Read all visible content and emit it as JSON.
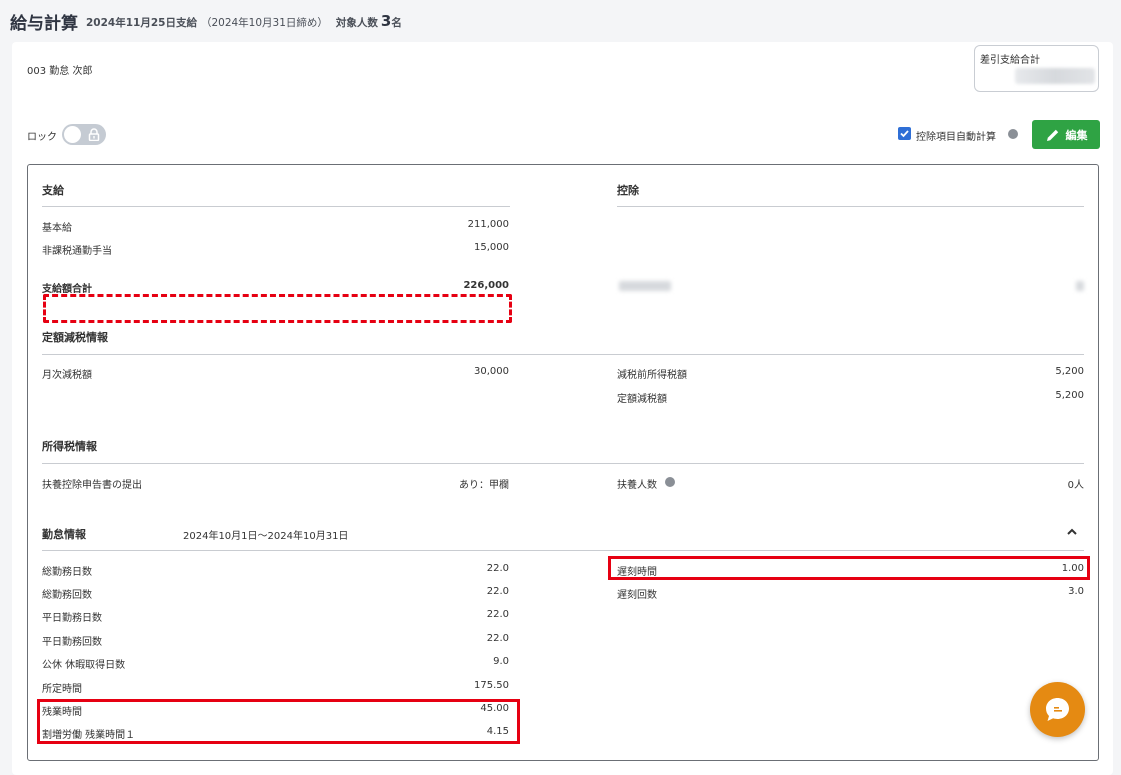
{
  "header": {
    "title": "給与計算",
    "payday": "2024年11月25日支給",
    "cutoff": "（2024年10月31日締め）",
    "count_label": "対象人数",
    "count_value": "3",
    "count_unit": "名"
  },
  "employee": {
    "label": "003  勤怠 次郎"
  },
  "net_total": {
    "label": "差引支給合計"
  },
  "lock": {
    "label": "ロック"
  },
  "auto_calc": {
    "label": "控除項目自動計算",
    "checked": true
  },
  "edit_button": {
    "label": "編集"
  },
  "sections": {
    "payment": {
      "title": "支給",
      "rows": [
        {
          "label": "基本給",
          "value": "211,000"
        },
        {
          "label": "非課税通勤手当",
          "value": "15,000"
        }
      ],
      "total": {
        "label": "支給額合計",
        "value": "226,000"
      }
    },
    "deduction": {
      "title": "控除"
    },
    "tax_reduction": {
      "title": "定額減税情報",
      "monthly_label": "月次減税額",
      "monthly_value": "30,000",
      "pre_tax_label": "減税前所得税額",
      "pre_tax_value": "5,200",
      "fixed_label": "定額減税額",
      "fixed_value": "5,200"
    },
    "income_tax": {
      "title": "所得税情報",
      "filing_label": "扶養控除申告書の提出",
      "filing_value": "あり：甲欄",
      "dependents_label": "扶養人数",
      "dependents_value": "0人"
    },
    "attendance": {
      "title": "勤怠情報",
      "period": "2024年10月1日〜2024年10月31日",
      "left_rows": [
        {
          "label": "総勤務日数",
          "value": "22.0"
        },
        {
          "label": "総勤務回数",
          "value": "22.0"
        },
        {
          "label": "平日勤務日数",
          "value": "22.0"
        },
        {
          "label": "平日勤務回数",
          "value": "22.0"
        },
        {
          "label": "公休 休暇取得日数",
          "value": "9.0"
        },
        {
          "label": "所定時間",
          "value": "175.50"
        },
        {
          "label": "残業時間",
          "value": "45.00"
        },
        {
          "label": "割増労働 残業時間１",
          "value": "4.15"
        }
      ],
      "right_rows": [
        {
          "label": "遅刻時間",
          "value": "1.00"
        },
        {
          "label": "遅刻回数",
          "value": "3.0"
        }
      ]
    }
  },
  "colors": {
    "highlight": "#e60012",
    "edit_button": "#2fa344",
    "checkbox": "#2f6fd6",
    "chat_button": "#e58a12"
  },
  "icons": [
    "lock-icon",
    "pencil-icon",
    "info-icon",
    "chevron-up-icon",
    "chat-icon",
    "checkmark-icon"
  ]
}
